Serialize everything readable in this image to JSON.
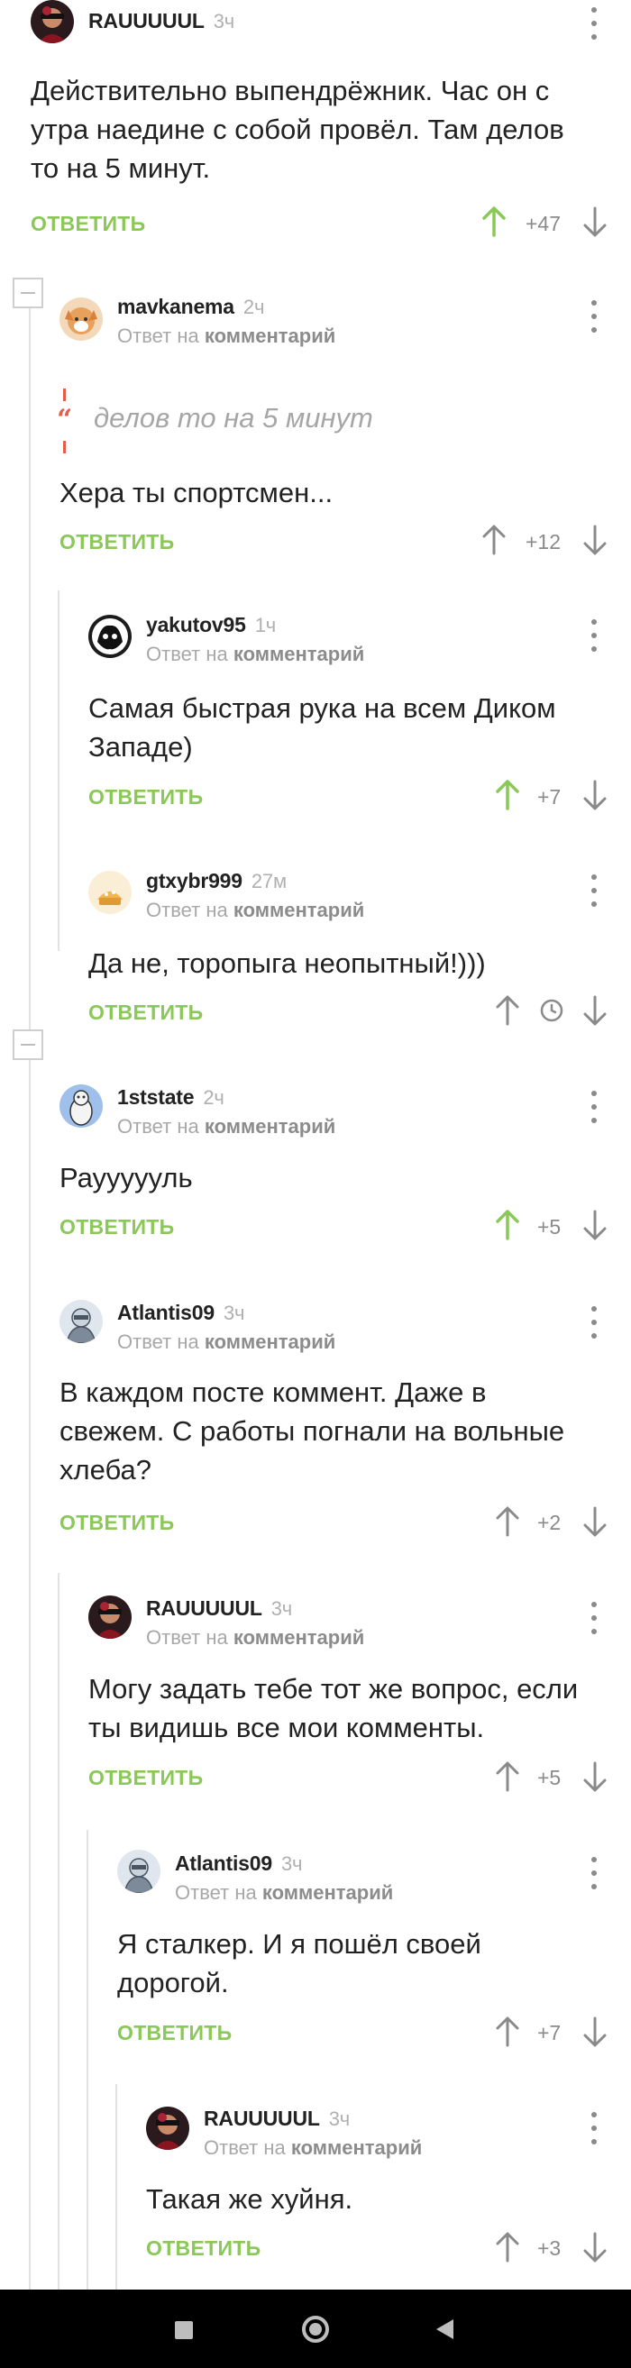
{
  "labels": {
    "reply": "ОТВЕТИТЬ",
    "reply_to_prefix": "Ответ на",
    "reply_to_target": "комментарий"
  },
  "colors": {
    "accent_green": "#8ac858",
    "vote_up_active": "#8ac858",
    "muted": "#8a8a8a"
  },
  "comments": [
    {
      "author": "RAUUUUUL",
      "time": "3ч",
      "lines": [
        "Действительно выпендрёжник. Час он с",
        "утра наедине с собой провёл. Там делов",
        "то на 5 минут."
      ],
      "score": "+47",
      "upvoted": true
    },
    {
      "author": "mavkanema",
      "time": "2ч",
      "quote": "делов то на 5 минут",
      "lines": [
        "Хера ты спортсмен..."
      ],
      "score": "+12",
      "upvoted": false
    },
    {
      "author": "yakutov95",
      "time": "1ч",
      "lines": [
        "Самая быстрая рука на всем Диком",
        "Западе)"
      ],
      "score": "+7",
      "upvoted": true
    },
    {
      "author": "gtxybr999",
      "time": "27м",
      "lines": [
        "Да не, торопыга неопытный!)))"
      ],
      "score": "",
      "upvoted": false,
      "pending": true
    },
    {
      "author": "1ststate",
      "time": "2ч",
      "lines": [
        "Рауууууль"
      ],
      "score": "+5",
      "upvoted": true
    },
    {
      "author": "Atlantis09",
      "time": "3ч",
      "lines": [
        "В каждом посте коммент. Даже в",
        "свежем. С работы погнали на вольные",
        "хлеба?"
      ],
      "score": "+2",
      "upvoted": false
    },
    {
      "author": "RAUUUUUL",
      "time": "3ч",
      "lines": [
        "Могу задать тебе тот же вопрос, если",
        "ты видишь все мои комменты."
      ],
      "score": "+5",
      "upvoted": false
    },
    {
      "author": "Atlantis09",
      "time": "3ч",
      "lines": [
        "Я сталкер. И я пошёл своей",
        "дорогой."
      ],
      "score": "+7",
      "upvoted": false
    },
    {
      "author": "RAUUUUUL",
      "time": "3ч",
      "lines": [
        "Такая же хуйня."
      ],
      "score": "+3",
      "upvoted": false
    }
  ],
  "navbar": {
    "icons": [
      "recent-apps-icon",
      "home-icon",
      "back-icon"
    ]
  }
}
